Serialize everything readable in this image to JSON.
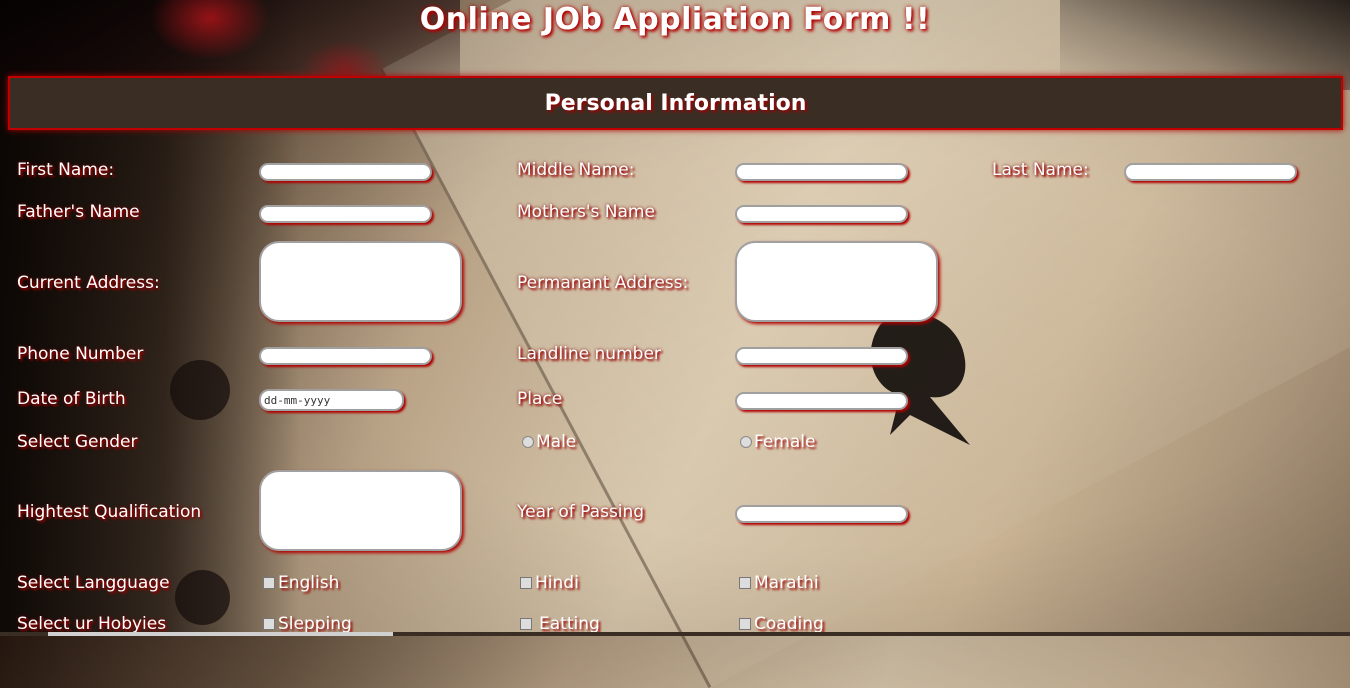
{
  "page": {
    "title": "Online JOb Appliation Form !!",
    "section_title": "Personal Information"
  },
  "fields": {
    "first_name_label": "First Name:",
    "middle_name_label": "Middle Name:",
    "last_name_label": "Last Name:",
    "father_name_label": "Father's Name",
    "mother_name_label": "Mothers's Name",
    "current_address_label": "Current Address:",
    "permanent_address_label": "Permanant Address:",
    "phone_label": "Phone Number",
    "landline_label": "Landline number",
    "dob_label": "Date of Birth",
    "dob_placeholder": "dd-mm-yyyy",
    "place_label": "Place",
    "gender_label": "Select Gender",
    "qualification_label": "Hightest Qualification",
    "year_passing_label": "Year of Passing",
    "language_label": "Select Langguage",
    "hobbies_label": "Select ur Hobyies"
  },
  "gender_options": [
    "Male",
    "Female"
  ],
  "language_options": [
    "English",
    "Hindi",
    "Marathi"
  ],
  "hobby_options": [
    "Slepping",
    "Eatting",
    "Coading"
  ],
  "colors": {
    "accent": "#b00000",
    "section_bg": "#3a2e24",
    "text": "#ffffff"
  }
}
